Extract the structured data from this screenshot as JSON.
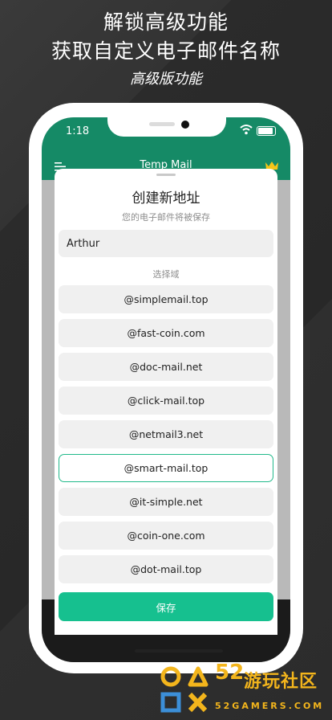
{
  "promo": {
    "line1": "解锁高级功能",
    "line2": "获取自定义电子邮件名称",
    "line3": "高级版功能"
  },
  "status": {
    "time": "1:18"
  },
  "appbar": {
    "title": "Temp Mail",
    "menu_icon": "menu-icon",
    "premium_icon": "crown-icon"
  },
  "sheet": {
    "title": "创建新地址",
    "subtitle": "您的电子邮件将被保存",
    "name_value": "Arthur",
    "domain_label": "选择域",
    "domains": [
      "@simplemail.top",
      "@fast-coin.com",
      "@doc-mail.net",
      "@click-mail.top",
      "@netmail3.net",
      "@smart-mail.top",
      "@it-simple.net",
      "@coin-one.com",
      "@dot-mail.top"
    ],
    "selected_domain": "@smart-mail.top",
    "save_label": "保存"
  },
  "watermark": {
    "number": "52",
    "brand": "游玩社区",
    "site": "52GAMERS.COM"
  },
  "colors": {
    "appbar": "#158a66",
    "accent": "#16c08f",
    "crown": "#f5c518",
    "watermark": "#f3b51c"
  }
}
